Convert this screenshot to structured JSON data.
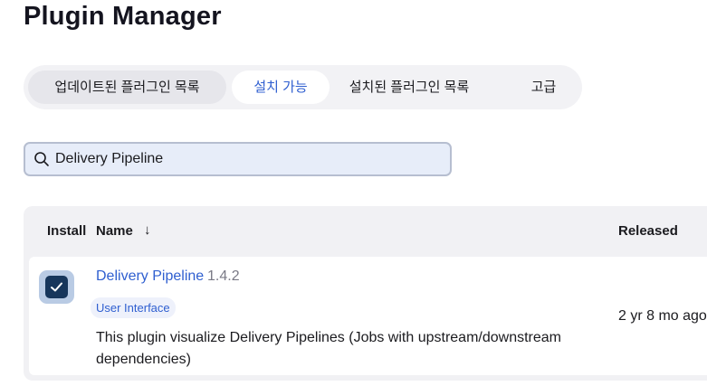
{
  "page": {
    "title": "Plugin Manager"
  },
  "tabs": [
    {
      "label": "업데이트된 플러그인 목록"
    },
    {
      "label": "설치 가능"
    },
    {
      "label": "설치된 플러그인 목록"
    },
    {
      "label": "고급"
    }
  ],
  "search": {
    "value": "Delivery Pipeline",
    "icon": "search-icon"
  },
  "table": {
    "headers": {
      "install": "Install",
      "name": "Name",
      "sort_indicator": "↓",
      "released": "Released"
    },
    "rows": [
      {
        "checked": true,
        "name": "Delivery Pipeline",
        "version": "1.4.2",
        "category": "User Interface",
        "description": "This plugin visualize Delivery Pipelines (Jobs with upstream/downstream dependencies)",
        "released": "2 yr 8 mo ago"
      }
    ]
  },
  "colors": {
    "accent": "#2f5fd0",
    "checkbox": "#17365b",
    "tab_bar": "#f2f2f5",
    "search_bg": "#e7edf9"
  }
}
